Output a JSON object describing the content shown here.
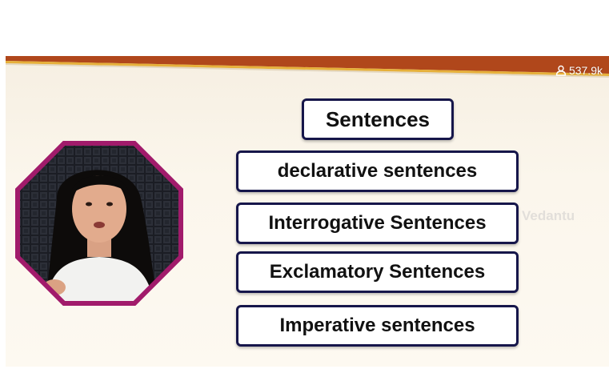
{
  "stream": {
    "viewer_count": "537.9k",
    "watermark": "Vedantu"
  },
  "slide": {
    "title": "Sentences",
    "items": [
      "declarative sentences",
      "Interrogative Sentences",
      "Exclamatory Sentences",
      "Imperative sentences"
    ]
  },
  "colors": {
    "box_border": "#16164a",
    "frame_accent": "#e6b03a",
    "header_band": "#b0471b",
    "presenter_ring": "#a11b6b",
    "background": "#fbf6ec"
  },
  "icons": {
    "viewer": "person-icon"
  }
}
